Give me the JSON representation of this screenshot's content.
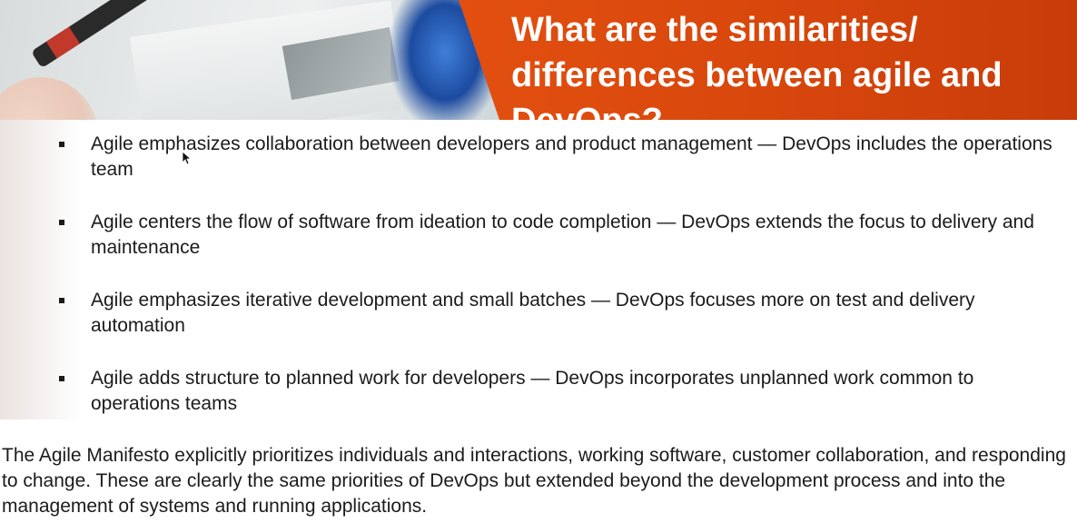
{
  "slide": {
    "title": "What are the similarities/ differences between agile and DevOps?",
    "bullets": [
      "Agile emphasizes collaboration between developers and product management — DevOps includes the operations team",
      "Agile centers the flow of software from ideation to code completion — DevOps extends the focus to delivery and maintenance",
      "Agile emphasizes iterative development and small batches — DevOps focuses more on test and delivery automation",
      "Agile adds structure to planned work for developers — DevOps incorporates unplanned work common to operations teams"
    ],
    "summary": "The Agile Manifesto explicitly prioritizes individuals and interactions, working software, customer collaboration, and responding to change. These are clearly the same priorities of DevOps but extended beyond the development process and into the management of systems and running applications."
  },
  "colors": {
    "banner": "#d8470c",
    "title_text": "#ffffff",
    "body_text": "#1b1b1b"
  },
  "icons": {
    "bullet": "square-bullet-icon",
    "cursor": "mouse-cursor-icon"
  }
}
